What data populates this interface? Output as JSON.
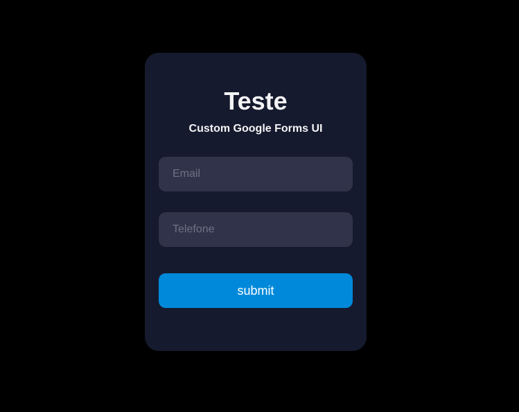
{
  "form": {
    "title": "Teste",
    "subtitle": "Custom Google Forms UI",
    "email_placeholder": "Email",
    "phone_placeholder": "Telefone",
    "submit_label": "submit"
  },
  "colors": {
    "background": "#000000",
    "card": "#161a2e",
    "input": "#30334a",
    "accent": "#0089da",
    "text": "#f4f4f6",
    "placeholder": "#6f7286"
  }
}
